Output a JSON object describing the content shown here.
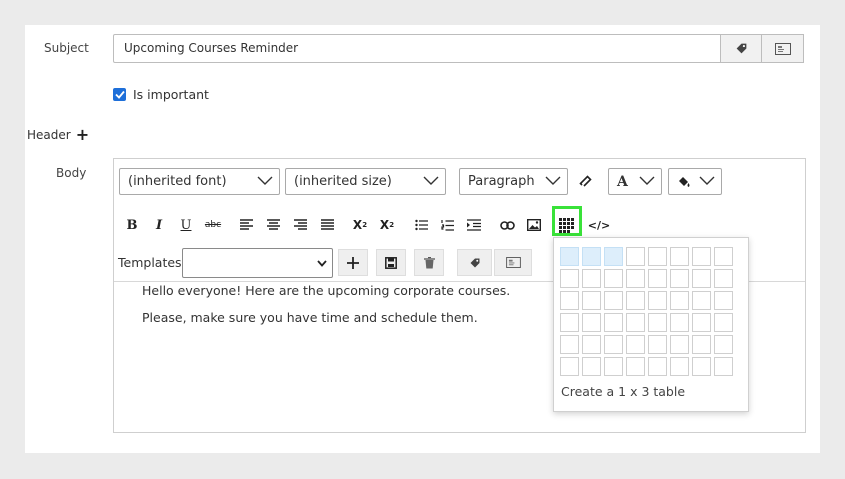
{
  "subject": {
    "label": "Subject",
    "value": "Upcoming Courses Reminder",
    "tag_button_icon": "tag-icon",
    "insert_field_button_icon": "insert-field-icon"
  },
  "important": {
    "label": "Is important",
    "checked": true
  },
  "header": {
    "label": "Header",
    "add_icon": "plus-icon"
  },
  "body": {
    "label": "Body",
    "font_select": "(inherited font)",
    "size_select": "(inherited size)",
    "format_select": "Paragraph",
    "templates_label": "Templates:",
    "lines": [
      "Hello everyone! Here are the upcoming corporate courses.",
      "Please, make sure you have time and schedule them."
    ]
  },
  "table_picker": {
    "rows": 6,
    "cols": 8,
    "selected_rows": 1,
    "selected_cols": 3,
    "caption": "Create a 1 x 3 table"
  },
  "colors": {
    "accent": "#1e6fd9",
    "highlight": "#39e239",
    "selected_cell": "#ddeefb"
  }
}
